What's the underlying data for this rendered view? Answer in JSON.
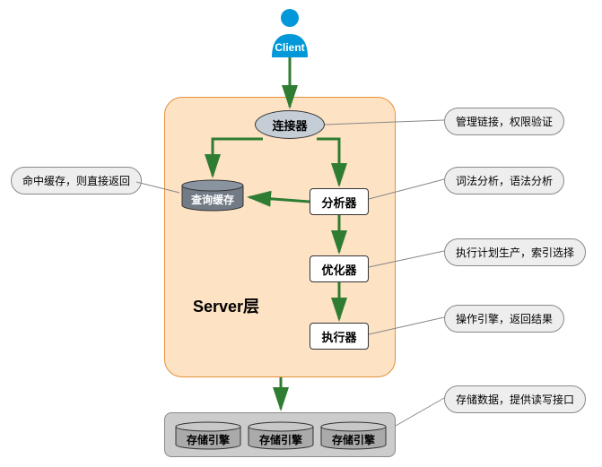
{
  "client": {
    "label": "Client"
  },
  "server": {
    "title": "Server层",
    "nodes": {
      "connector": "连接器",
      "cache": "查询缓存",
      "analyzer": "分析器",
      "optimizer": "优化器",
      "executor": "执行器"
    }
  },
  "storage": {
    "engines": [
      "存储引擎",
      "存储引擎",
      "存储引擎"
    ]
  },
  "callouts": {
    "cache": "命中缓存，则直接返回",
    "connector": "管理链接，权限验证",
    "analyzer": "词法分析，语法分析",
    "optimizer": "执行计划生产，索引选择",
    "executor": "操作引擎，返回结果",
    "storage": "存储数据，提供读写接口"
  }
}
